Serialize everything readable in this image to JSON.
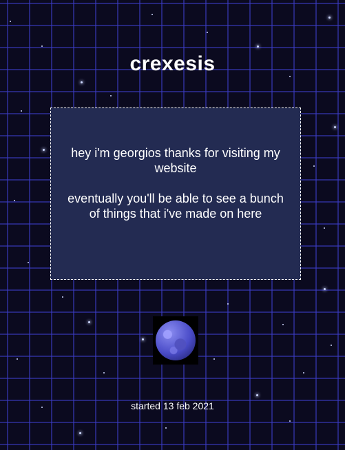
{
  "header": {
    "title": "crexesis"
  },
  "intro": {
    "greeting": "hey i'm georgios thanks for visiting my website",
    "message": "eventually you'll be able to see a bunch of things that i've made on here"
  },
  "footer": {
    "started": "started 13 feb 2021"
  },
  "theme": {
    "background": "#0b0a1f",
    "grid": "#3c3cc8",
    "box": "#232b52",
    "text": "#ffffff"
  },
  "decoration": {
    "planet_icon": "planet-icon"
  }
}
